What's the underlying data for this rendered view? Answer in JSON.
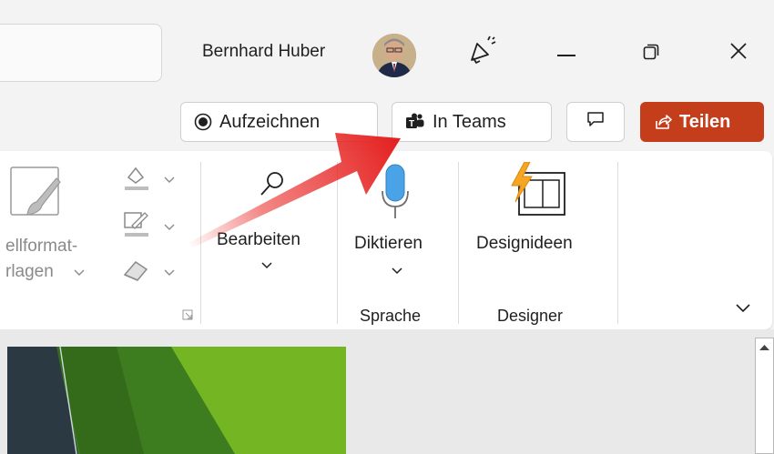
{
  "titlebar": {
    "user_name": "Bernhard Huber"
  },
  "actions": {
    "record_label": "Aufzeichnen",
    "teams_label": "In Teams",
    "share_label": "Teilen"
  },
  "ribbon": {
    "styles_partial_line1": "ellformat-",
    "styles_partial_line2": "rlagen",
    "edit_label": "Bearbeiten",
    "dictate_label": "Diktieren",
    "designideas_label": "Designideen",
    "group_speech": "Sprache",
    "group_designer": "Designer"
  },
  "colors": {
    "share_accent": "#c43e1c",
    "annotation_arrow": "#e8231f",
    "mic_blue": "#4aa3e6"
  },
  "icons": {
    "feedback": "megaphone-icon",
    "record": "record-icon",
    "teams": "teams-icon",
    "comments": "comment-icon",
    "share": "share-icon",
    "edit": "search-icon",
    "dictate": "microphone-icon",
    "designideas": "design-ideas-icon"
  }
}
